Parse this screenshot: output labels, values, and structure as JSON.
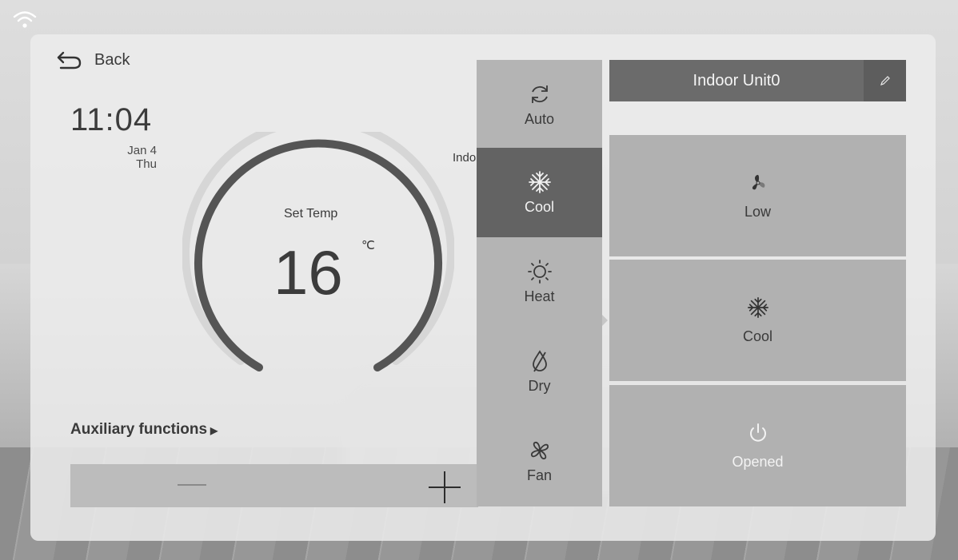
{
  "header": {
    "back_label": "Back"
  },
  "clock": {
    "time": "11:04",
    "date": "Jan 4",
    "weekday": "Thu"
  },
  "thermostat": {
    "set_temp_label": "Set Temp",
    "value": "16",
    "unit": "℃"
  },
  "indoor_label_partial": "Indo",
  "auxiliary": {
    "label": "Auxiliary functions",
    "arrow": "▶"
  },
  "mode_menu": {
    "items": [
      {
        "label": "Auto",
        "icon": "refresh-icon",
        "active": false
      },
      {
        "label": "Cool",
        "icon": "snowflake-icon",
        "active": true
      },
      {
        "label": "Heat",
        "icon": "sun-icon",
        "active": false
      },
      {
        "label": "Dry",
        "icon": "drop-icon",
        "active": false
      },
      {
        "label": "Fan",
        "icon": "fan-icon",
        "active": false
      }
    ]
  },
  "unit": {
    "name": "Indoor Unit0",
    "edit_icon": "pencil-icon"
  },
  "cards": {
    "fan_speed": {
      "label": "Low",
      "icon": "fan-speed-icon"
    },
    "mode": {
      "label": "Cool",
      "icon": "snowflake-icon"
    },
    "power": {
      "label": "Opened",
      "icon": "power-icon"
    }
  },
  "colors": {
    "active_mode_bg": "#636363",
    "unit_header_bg": "#6b6b6b",
    "arc": "#555555"
  }
}
